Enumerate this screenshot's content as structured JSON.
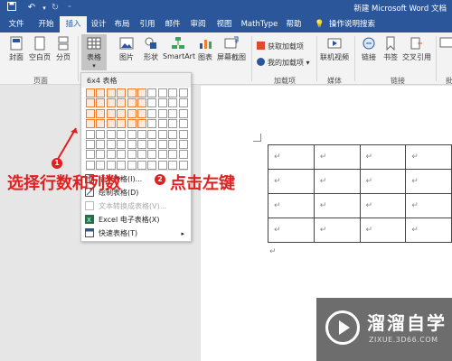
{
  "title_bar": {
    "document_title": "新建 Microsoft Word 文档"
  },
  "tabs": [
    "文件",
    "开始",
    "插入",
    "设计",
    "布局",
    "引用",
    "邮件",
    "审阅",
    "视图",
    "MathType",
    "帮助"
  ],
  "active_tab": "插入",
  "tell_me": "操作说明搜索",
  "ribbon": {
    "cover": "封面",
    "blank_page": "空白页",
    "page_break": "分页",
    "pages_group": "页面",
    "table": "表格",
    "pictures": "图片",
    "shapes": "形状",
    "smartart": "SmartArt",
    "chart": "图表",
    "screenshot": "屏幕截图",
    "get_addins": "获取加载项",
    "my_addins": "我的加载项",
    "addins_group": "加载项",
    "online_video": "联机视频",
    "media_group": "媒体",
    "link": "链接",
    "bookmark": "书签",
    "cross_ref": "交叉引用",
    "links_group": "链接",
    "comment_partial": "批"
  },
  "dropdown": {
    "header": "6x4 表格",
    "grid_cols": 10,
    "grid_rows": 8,
    "selected_cols": 6,
    "selected_rows": 4,
    "items": [
      {
        "label": "插入表格(I)...",
        "disabled": false
      },
      {
        "label": "绘制表格(D)",
        "disabled": false
      },
      {
        "label": "文本转换成表格(V)...",
        "disabled": true
      },
      {
        "label": "Excel 电子表格(X)",
        "disabled": false
      },
      {
        "label": "快速表格(T)",
        "disabled": false
      }
    ]
  },
  "document": {
    "paragraph_mark": "↵",
    "table_rows": 4,
    "table_cols": 4
  },
  "annotations": {
    "step1_number": "1",
    "step1_text": "选择行数和列数",
    "step2_number": "2",
    "step2_text": "点击左键"
  },
  "watermark": {
    "title": "溜溜自学",
    "url": "ZIXUE.3D66.COM"
  },
  "colors": {
    "accent": "#2b579a",
    "selection": "#ed7d31",
    "annotation": "#e02020"
  }
}
